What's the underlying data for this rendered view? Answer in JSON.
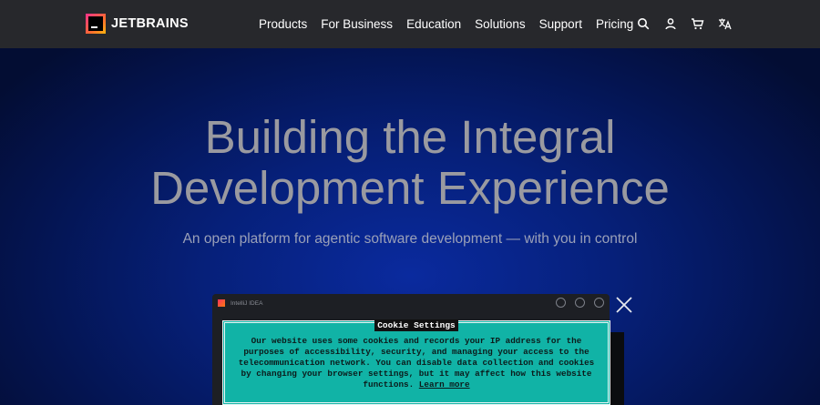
{
  "brand": {
    "name": "JETBRAINS"
  },
  "nav": {
    "items": [
      "Products",
      "For Business",
      "Education",
      "Solutions",
      "Support",
      "Pricing"
    ]
  },
  "header_icons": [
    "search-icon",
    "user-icon",
    "cart-icon",
    "translate-icon"
  ],
  "hero": {
    "title_line1": "Building the Integral",
    "title_line2": "Development Experience",
    "subtitle": "An open platform for agentic software development — with you in control"
  },
  "ide": {
    "title": "IntelliJ IDEA"
  },
  "cookie": {
    "title": "Cookie Settings",
    "text": "Our website uses some cookies and records your IP address for the purposes of accessibility, security, and managing your access to the telecommunication network. You can disable data collection and cookies by changing your browser settings, but it may affect how this website functions.",
    "link": "Learn more"
  },
  "colors": {
    "header_bg": "#27282c",
    "hero_bg": "#06207a",
    "cookie_bg": "#11b3a6"
  }
}
